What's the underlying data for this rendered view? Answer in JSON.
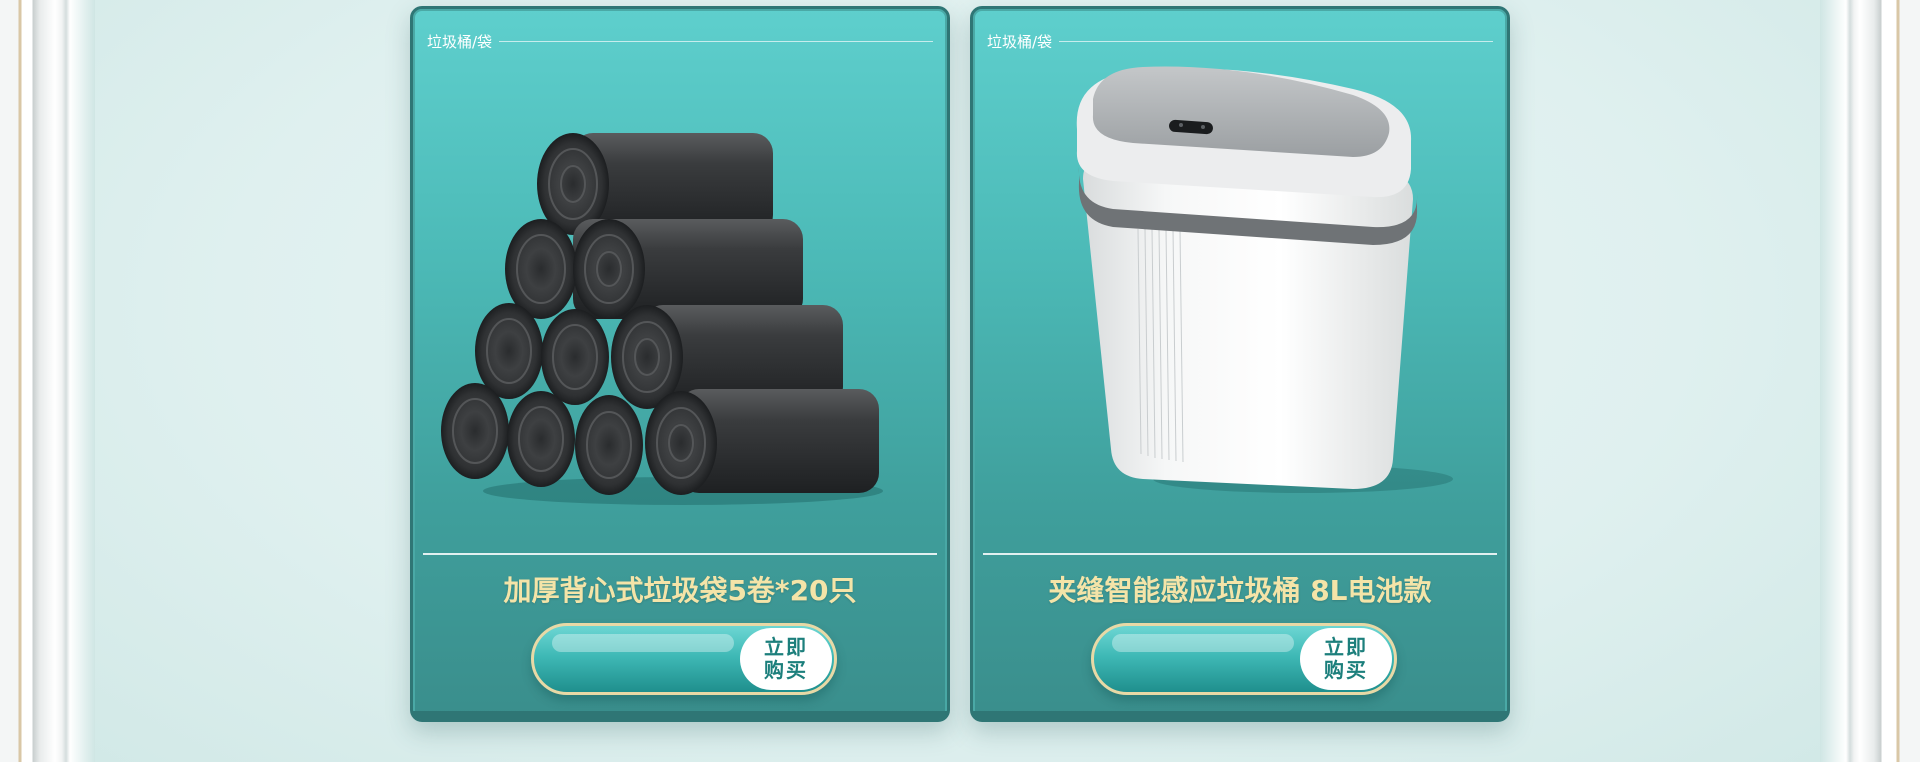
{
  "products": [
    {
      "category_tag": "垃圾桶/袋",
      "name": "加厚背心式垃圾袋5卷*20只",
      "buy_label": "立即购买",
      "image_icon": "trash-bag-rolls-icon"
    },
    {
      "category_tag": "垃圾桶/袋",
      "name": "夹缝智能感应垃圾桶 8L电池款",
      "buy_label": "立即购买",
      "image_icon": "smart-trash-can-icon"
    }
  ],
  "colors": {
    "card_top": "#5ecfcd",
    "card_bottom": "#3a8e8c",
    "card_border": "#2f7675",
    "title_gold": "#f4e4a8",
    "button_teal": "#1c7f7c",
    "page_bg": "#e2f2f1"
  }
}
